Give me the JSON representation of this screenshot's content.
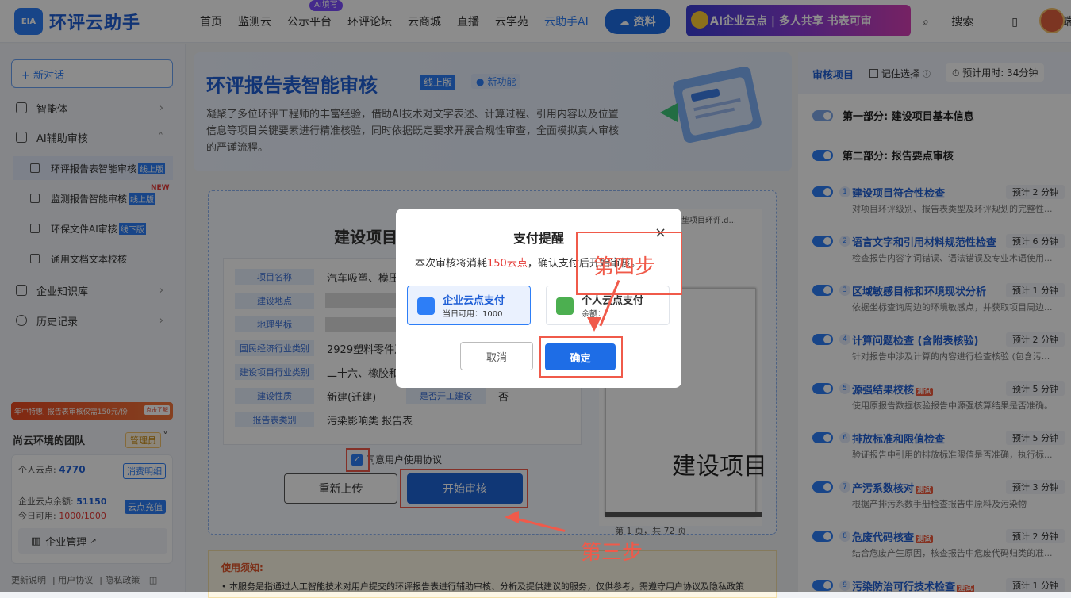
{
  "header": {
    "logo_mark": "EIA",
    "logo_text": "环评云助手",
    "nav": [
      "首页",
      "监测云",
      "公示平台",
      "环评论坛",
      "云商城",
      "直播",
      "云学苑",
      "云助手AI"
    ],
    "nav_badge": "AI填写",
    "resource_button": "资料",
    "banner_text": "AI企业云点 | 多人共享 书表可审",
    "search_label": "搜索",
    "client_label": "客户端"
  },
  "sidebar": {
    "new_chat": "+ 新对话",
    "agent": "智能体",
    "ai_review": "AI辅助审核",
    "sub_items": [
      {
        "label": "环评报告表智能审核",
        "tag": "线上版"
      },
      {
        "label": "监测报告智能审核",
        "tag": "线上版",
        "badge": "NEW"
      },
      {
        "label": "环保文件AI审核",
        "tag": "线下版"
      },
      {
        "label": "通用文档文本校核",
        "tag": ""
      }
    ],
    "knowledge": "企业知识库",
    "history": "历史记录",
    "promo": "年中特惠, 报告表审核仅需150元/份",
    "promo_btn": "点击了解",
    "team_name": "尚云环境的团队",
    "admin_badge": "管理员",
    "personal_points_label": "个人云点:",
    "personal_points": "4770",
    "consume_detail": "消费明细",
    "enterprise_balance_label": "企业云点余额:",
    "enterprise_balance": "51150",
    "today_label": "今日可用:",
    "today_value": "1000/1000",
    "recharge": "云点充值",
    "enterprise_mgmt": "企业管理",
    "footer_links": [
      "更新说明",
      "用户协议",
      "隐私政策"
    ]
  },
  "hero": {
    "title": "环评报告表智能审核",
    "tag": "线上版",
    "new_feature": "新功能",
    "description": "凝聚了多位环评工程师的丰富经验，借助AI技术对文字表述、计算过程、引用内容以及位置信息等项目关键要素进行精准核验，同时依据既定要求开展合规性审查，全面模拟真人审核的严谨流程。"
  },
  "project": {
    "title": "建设项目",
    "rows": [
      {
        "label": "项目名称",
        "value": "汽车吸塑、模压"
      },
      {
        "label": "建设地点",
        "value": ""
      },
      {
        "label": "地理坐标",
        "value": ""
      },
      {
        "label": "国民经济行业类别",
        "value": "2929塑料零件及"
      },
      {
        "label": "建设项目行业类别",
        "value": "二十六、橡胶和"
      },
      {
        "label": "建设性质",
        "value": "新建(迁建)",
        "label2": "是否开工建设",
        "value2": "否"
      },
      {
        "label": "报告表类别",
        "value": "污染影响类 报告表"
      }
    ],
    "agree_text": "同意用户使用协议",
    "reupload": "重新上传",
    "start_review": "开始审核",
    "preview_filename": "脚垫项目环评.d...",
    "preview_big_text": "建设项目",
    "preview_page_info": "第 1 页，共 72 页"
  },
  "notice": {
    "title": "使用须知:",
    "text": "• 本服务是指通过人工智能技术对用户提交的环评报告表进行辅助审核、分析及提供建议的服务，仅供参考，需遵守用户协议及隐私政策"
  },
  "review_panel": {
    "title": "审核项目",
    "remember": "记住选择",
    "est_time": "预计用时: 34分钟",
    "section1": "第一部分: 建设项目基本信息",
    "section2": "第二部分: 报告要点审核",
    "items": [
      {
        "num": "1",
        "name": "建设项目符合性检查",
        "est": "预计 2 分钟",
        "desc": "对项目环评级别、报告表类型及环评规划的完整性..."
      },
      {
        "num": "2",
        "name": "语言文字和引用材料规范性检查",
        "est": "预计 6 分钟",
        "desc": "检查报告内容字词错误、语法错误及专业术语使用..."
      },
      {
        "num": "3",
        "name": "区域敏感目标和环境现状分析",
        "est": "预计 1 分钟",
        "desc": "依据坐标查询周边的环境敏感点，并获取项目周边..."
      },
      {
        "num": "4",
        "name": "计算问题检查 (含附表核验)",
        "est": "预计 2 分钟",
        "desc": "针对报告中涉及计算的内容进行检查核验 (包含污..."
      },
      {
        "num": "5",
        "name": "源强结果校核",
        "beta": "测试",
        "est": "预计 5 分钟",
        "desc": "使用原报告数据核验报告中源强核算结果是否准确。"
      },
      {
        "num": "6",
        "name": "排放标准和限值检查",
        "est": "预计 5 分钟",
        "desc": "验证报告中引用的排放标准限值是否准确，执行标..."
      },
      {
        "num": "7",
        "name": "产污系数核对",
        "beta": "测试",
        "est": "预计 3 分钟",
        "desc": "根据产排污系数手册检查报告中原料及污染物"
      },
      {
        "num": "8",
        "name": "危废代码核查",
        "beta": "测试",
        "est": "预计 2 分钟",
        "desc": "结合危废产生原因，核查报告中危废代码归类的准..."
      },
      {
        "num": "9",
        "name": "污染防治可行技术检查",
        "beta": "测试",
        "est": "预计 1 分钟",
        "desc": ""
      }
    ]
  },
  "modal": {
    "title": "支付提醒",
    "close": "×",
    "msg_prefix": "本次审核将消耗",
    "msg_amount": "150云点",
    "msg_suffix": "，确认支付后开始审核。",
    "option1_name": "企业云点支付",
    "option1_sub": "当日可用：1000",
    "option2_name": "个人云点支付",
    "option2_sub": "余额：",
    "cancel": "取消",
    "confirm": "确定"
  },
  "annotations": {
    "step3": "第三步",
    "step4": "第四步"
  },
  "colors": {
    "primary": "#2d7ef7",
    "highlight_red": "#f05a4a",
    "beta_red": "#f25a3c"
  }
}
